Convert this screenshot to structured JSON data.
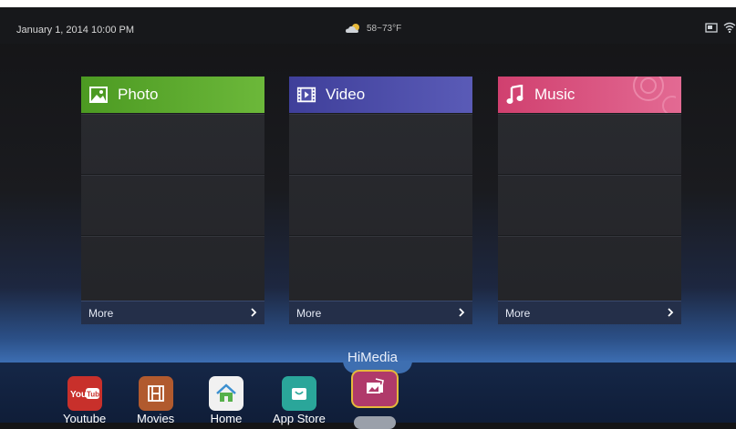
{
  "status": {
    "datetime": "January 1, 2014  10:00 PM",
    "weather": "58~73°F",
    "weather_icon": "cloud-sun-icon",
    "sys_icons": [
      "screen-icon",
      "wifi-icon"
    ]
  },
  "cards": [
    {
      "title": "Photo",
      "icon": "photo-icon",
      "color": "#5aa32c",
      "more": "More"
    },
    {
      "title": "Video",
      "icon": "video-icon",
      "color": "#4e4fa8",
      "more": "More"
    },
    {
      "title": "Music",
      "icon": "music-icon",
      "color": "#d6487a",
      "more": "More"
    }
  ],
  "dock": {
    "apps": [
      {
        "label": "Youtube",
        "badge": "You Tube",
        "color": "#c8302b",
        "icon": "youtube-icon"
      },
      {
        "label": "Movies",
        "color": "#b15a2e",
        "icon": "film-icon"
      },
      {
        "label": "Home",
        "color": "#f1f1f1",
        "icon": "home-icon"
      },
      {
        "label": "App Store",
        "color": "#2aa69a",
        "icon": "app-store-icon"
      }
    ],
    "selected": {
      "label": "HiMedia",
      "color": "#b03a6a",
      "icon": "himedia-icon"
    }
  }
}
